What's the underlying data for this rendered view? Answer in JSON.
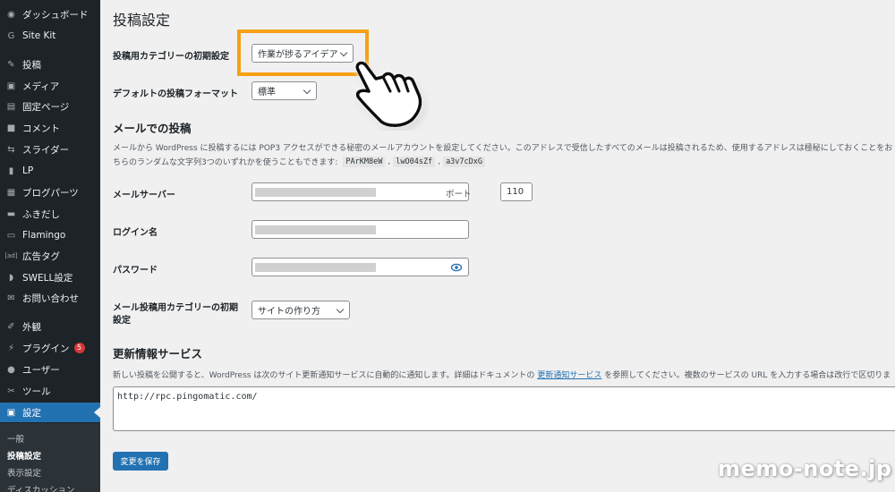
{
  "colors": {
    "sidebar_bg": "#1d2327",
    "active_bg": "#2271b1",
    "highlight": "#f5a015",
    "page_bg": "#f0f0f1"
  },
  "sidebar": {
    "items": [
      {
        "label": "ダッシュボード",
        "icon": "dashboard-icon",
        "glyph": "◉"
      },
      {
        "label": "Site Kit",
        "icon": "google-g-icon",
        "glyph": "G"
      },
      {
        "label": "投稿",
        "icon": "pin-icon",
        "glyph": "✎"
      },
      {
        "label": "メディア",
        "icon": "media-icon",
        "glyph": "▣"
      },
      {
        "label": "固定ページ",
        "icon": "page-icon",
        "glyph": "▤"
      },
      {
        "label": "コメント",
        "icon": "comment-icon",
        "glyph": "■"
      },
      {
        "label": "スライダー",
        "icon": "slider-icon",
        "glyph": "⇆"
      },
      {
        "label": "LP",
        "icon": "document-icon",
        "glyph": "▮"
      },
      {
        "label": "ブログパーツ",
        "icon": "table-icon",
        "glyph": "▦"
      },
      {
        "label": "ふきだし",
        "icon": "speech-bubble-icon",
        "glyph": "▬"
      },
      {
        "label": "Flamingo",
        "icon": "flamingo-icon",
        "glyph": "▭"
      },
      {
        "label": "広告タグ",
        "icon": "ad-icon",
        "glyph": "[ad]"
      },
      {
        "label": "SWELL設定",
        "icon": "swell-icon",
        "glyph": "◗"
      },
      {
        "label": "お問い合わせ",
        "icon": "mail-icon",
        "glyph": "✉"
      },
      {
        "label": "外観",
        "icon": "brush-icon",
        "glyph": "✐"
      },
      {
        "label": "プラグイン",
        "icon": "plugin-icon",
        "glyph": "⚡",
        "badge": "5"
      },
      {
        "label": "ユーザー",
        "icon": "user-icon",
        "glyph": "●"
      },
      {
        "label": "ツール",
        "icon": "wrench-icon",
        "glyph": "✂"
      },
      {
        "label": "設定",
        "icon": "settings-icon",
        "glyph": "▣"
      }
    ],
    "submenu": [
      "一般",
      "投稿設定",
      "表示設定",
      "ディスカッション"
    ]
  },
  "main": {
    "title": "投稿設定",
    "default_category": {
      "label": "投稿用カテゴリーの初期設定",
      "value": "作業が捗るアイデア"
    },
    "default_format": {
      "label": "デフォルトの投稿フォーマット",
      "value": "標準"
    },
    "mail_section": {
      "title": "メールでの投稿",
      "desc_line1": "メールから WordPress に投稿するには POP3 アクセスができる秘密のメールアカウントを設定してください。このアドレスで受信したすべてのメールは投稿されるため、使用するアドレスは極秘にしておくことをお",
      "desc_line2_prefix": "ちらのランダムな文字列3つのいずれかを使うこともできます:",
      "codes": [
        "PArKM8eW",
        "lwO04sZf",
        "a3v7cDxG"
      ],
      "comma": ","
    },
    "mail_server": {
      "label": "メールサーバー",
      "port_label": "ポート",
      "port_value": "110"
    },
    "login_name": {
      "label": "ログイン名"
    },
    "password": {
      "label": "パスワード"
    },
    "mail_category": {
      "label_line1": "メール投稿用カテゴリーの初期",
      "label_line2": "設定",
      "value": "サイトの作り方"
    },
    "update_services": {
      "title": "更新情報サービス",
      "desc_before": "新しい投稿を公開すると、WordPress は次のサイト更新通知サービスに自動的に通知します。詳細はドキュメントの",
      "link": "更新通知サービス",
      "desc_after": "を参照してください。複数のサービスの URL を入力する場合は改行で区切りま",
      "textarea_value": "http://rpc.pingomatic.com/"
    },
    "save_button": "変更を保存"
  },
  "watermark": "memo-note.jp"
}
